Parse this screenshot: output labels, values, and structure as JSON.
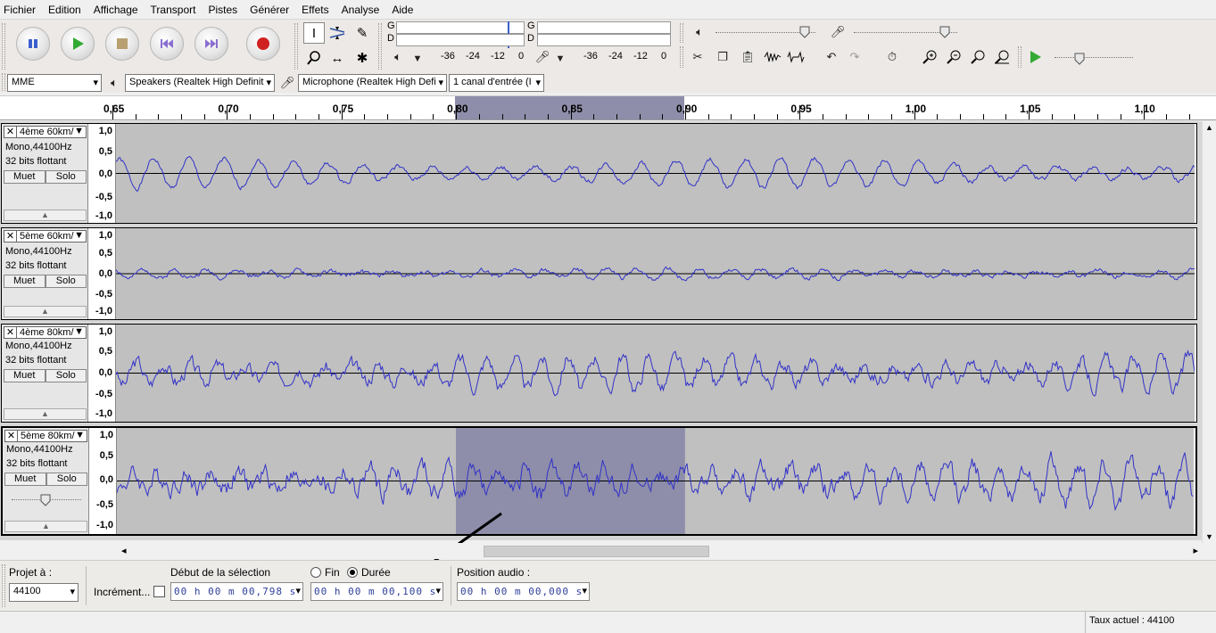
{
  "menu": [
    "Fichier",
    "Edition",
    "Affichage",
    "Transport",
    "Pistes",
    "Générer",
    "Effets",
    "Analyse",
    "Aide"
  ],
  "meters": {
    "play_ch_top": "G",
    "play_ch_bottom": "D",
    "play_scale": [
      "-36",
      "-24",
      "-12",
      "0"
    ],
    "rec_ch_top": "G",
    "rec_ch_bottom": "D",
    "rec_scale": [
      "-36",
      "-24",
      "-12",
      "0"
    ]
  },
  "devices": {
    "host": "MME",
    "output": "Speakers (Realtek High Definit",
    "input": "Microphone (Realtek High Defi",
    "channels": "1 canal d'entrée (I"
  },
  "ruler": {
    "labels": [
      "0,65",
      "0,70",
      "0,75",
      "0,80",
      "0,85",
      "0,90",
      "0,95",
      "1,00",
      "1,05",
      "1,10"
    ],
    "start": 0.65,
    "end": 1.122,
    "selection": [
      0.798,
      0.898
    ]
  },
  "scale_labels": [
    "1,0",
    "0,5",
    "0,0",
    "-0,5",
    "-1,0"
  ],
  "tracks": [
    {
      "name": "4ème 60km/",
      "format": "Mono,44100Hz",
      "depth": "32 bits flottant",
      "mute": "Muet",
      "solo": "Solo",
      "amp": 0.32,
      "noise": 0.05,
      "freq": 31,
      "seed": 1
    },
    {
      "name": "5ème 60km/",
      "format": "Mono,44100Hz",
      "depth": "32 bits flottant",
      "mute": "Muet",
      "solo": "Solo",
      "amp": 0.12,
      "noise": 0.05,
      "freq": 35,
      "seed": 2
    },
    {
      "name": "4ème 80km/",
      "format": "Mono,44100Hz",
      "depth": "32 bits flottant",
      "mute": "Muet",
      "solo": "Solo",
      "amp": 0.38,
      "noise": 0.14,
      "freq": 40,
      "seed": 3
    },
    {
      "name": "5ème 80km/",
      "format": "Mono,44100Hz",
      "depth": "32 bits flottant",
      "mute": "Muet",
      "solo": "Solo",
      "amp": 0.3,
      "noise": 0.18,
      "freq": 41,
      "seed": 4
    }
  ],
  "selection_toolbar": {
    "project_rate_label": "Projet à :",
    "project_rate": "44100",
    "snap_label": "Incrément...",
    "start_label": "Début de la sélection",
    "end_option": "Fin",
    "length_option": "Durée",
    "start_time": "00 h 00 m 00,798 s",
    "length_time": "00 h 00 m 00,100 s",
    "audio_pos_label": "Position audio :",
    "audio_pos_time": "00 h 00 m 00,000 s"
  },
  "status": {
    "rate": "Taux actuel : 44100"
  },
  "colors": {
    "waveform": "#3232c8",
    "selection": "#8e8eaa",
    "track_bg": "#c0c0c0",
    "play": "#33aa33",
    "record": "#d02020",
    "transport_blue": "#3a5fcd"
  }
}
